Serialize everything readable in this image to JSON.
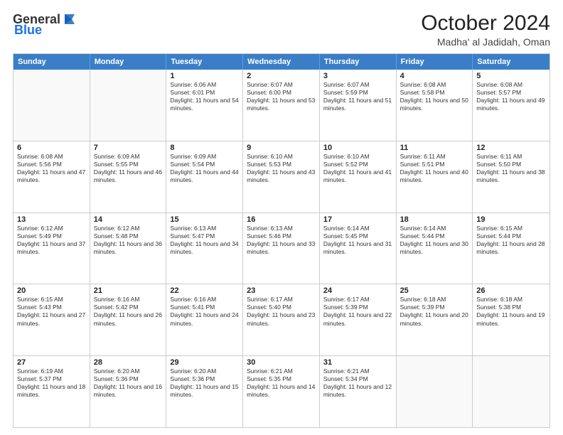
{
  "logo": {
    "general": "General",
    "blue": "Blue"
  },
  "title": "October 2024",
  "location": "Madha' al Jadidah, Oman",
  "weekdays": [
    "Sunday",
    "Monday",
    "Tuesday",
    "Wednesday",
    "Thursday",
    "Friday",
    "Saturday"
  ],
  "rows": [
    [
      {
        "day": "",
        "text": ""
      },
      {
        "day": "",
        "text": ""
      },
      {
        "day": "1",
        "text": "Sunrise: 6:06 AM\nSunset: 6:01 PM\nDaylight: 11 hours and 54 minutes."
      },
      {
        "day": "2",
        "text": "Sunrise: 6:07 AM\nSunset: 6:00 PM\nDaylight: 11 hours and 53 minutes."
      },
      {
        "day": "3",
        "text": "Sunrise: 6:07 AM\nSunset: 5:59 PM\nDaylight: 11 hours and 51 minutes."
      },
      {
        "day": "4",
        "text": "Sunrise: 6:08 AM\nSunset: 5:58 PM\nDaylight: 11 hours and 50 minutes."
      },
      {
        "day": "5",
        "text": "Sunrise: 6:08 AM\nSunset: 5:57 PM\nDaylight: 11 hours and 49 minutes."
      }
    ],
    [
      {
        "day": "6",
        "text": "Sunrise: 6:08 AM\nSunset: 5:56 PM\nDaylight: 11 hours and 47 minutes."
      },
      {
        "day": "7",
        "text": "Sunrise: 6:09 AM\nSunset: 5:55 PM\nDaylight: 11 hours and 46 minutes."
      },
      {
        "day": "8",
        "text": "Sunrise: 6:09 AM\nSunset: 5:54 PM\nDaylight: 11 hours and 44 minutes."
      },
      {
        "day": "9",
        "text": "Sunrise: 6:10 AM\nSunset: 5:53 PM\nDaylight: 11 hours and 43 minutes."
      },
      {
        "day": "10",
        "text": "Sunrise: 6:10 AM\nSunset: 5:52 PM\nDaylight: 11 hours and 41 minutes."
      },
      {
        "day": "11",
        "text": "Sunrise: 6:11 AM\nSunset: 5:51 PM\nDaylight: 11 hours and 40 minutes."
      },
      {
        "day": "12",
        "text": "Sunrise: 6:11 AM\nSunset: 5:50 PM\nDaylight: 11 hours and 38 minutes."
      }
    ],
    [
      {
        "day": "13",
        "text": "Sunrise: 6:12 AM\nSunset: 5:49 PM\nDaylight: 11 hours and 37 minutes."
      },
      {
        "day": "14",
        "text": "Sunrise: 6:12 AM\nSunset: 5:48 PM\nDaylight: 11 hours and 36 minutes."
      },
      {
        "day": "15",
        "text": "Sunrise: 6:13 AM\nSunset: 5:47 PM\nDaylight: 11 hours and 34 minutes."
      },
      {
        "day": "16",
        "text": "Sunrise: 6:13 AM\nSunset: 5:46 PM\nDaylight: 11 hours and 33 minutes."
      },
      {
        "day": "17",
        "text": "Sunrise: 6:14 AM\nSunset: 5:45 PM\nDaylight: 11 hours and 31 minutes."
      },
      {
        "day": "18",
        "text": "Sunrise: 6:14 AM\nSunset: 5:44 PM\nDaylight: 11 hours and 30 minutes."
      },
      {
        "day": "19",
        "text": "Sunrise: 6:15 AM\nSunset: 5:44 PM\nDaylight: 11 hours and 28 minutes."
      }
    ],
    [
      {
        "day": "20",
        "text": "Sunrise: 6:15 AM\nSunset: 5:43 PM\nDaylight: 11 hours and 27 minutes."
      },
      {
        "day": "21",
        "text": "Sunrise: 6:16 AM\nSunset: 5:42 PM\nDaylight: 11 hours and 26 minutes."
      },
      {
        "day": "22",
        "text": "Sunrise: 6:16 AM\nSunset: 5:41 PM\nDaylight: 11 hours and 24 minutes."
      },
      {
        "day": "23",
        "text": "Sunrise: 6:17 AM\nSunset: 5:40 PM\nDaylight: 11 hours and 23 minutes."
      },
      {
        "day": "24",
        "text": "Sunrise: 6:17 AM\nSunset: 5:39 PM\nDaylight: 11 hours and 22 minutes."
      },
      {
        "day": "25",
        "text": "Sunrise: 6:18 AM\nSunset: 5:39 PM\nDaylight: 11 hours and 20 minutes."
      },
      {
        "day": "26",
        "text": "Sunrise: 6:18 AM\nSunset: 5:38 PM\nDaylight: 11 hours and 19 minutes."
      }
    ],
    [
      {
        "day": "27",
        "text": "Sunrise: 6:19 AM\nSunset: 5:37 PM\nDaylight: 11 hours and 18 minutes."
      },
      {
        "day": "28",
        "text": "Sunrise: 6:20 AM\nSunset: 5:36 PM\nDaylight: 11 hours and 16 minutes."
      },
      {
        "day": "29",
        "text": "Sunrise: 6:20 AM\nSunset: 5:36 PM\nDaylight: 11 hours and 15 minutes."
      },
      {
        "day": "30",
        "text": "Sunrise: 6:21 AM\nSunset: 5:35 PM\nDaylight: 11 hours and 14 minutes."
      },
      {
        "day": "31",
        "text": "Sunrise: 6:21 AM\nSunset: 5:34 PM\nDaylight: 11 hours and 12 minutes."
      },
      {
        "day": "",
        "text": ""
      },
      {
        "day": "",
        "text": ""
      }
    ]
  ]
}
